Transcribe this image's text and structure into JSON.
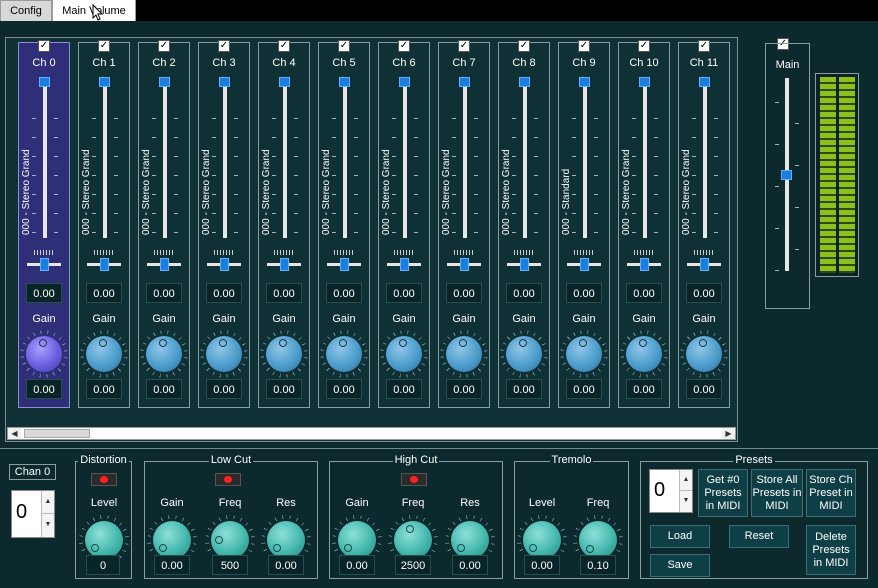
{
  "tabs": [
    {
      "label": "Config"
    },
    {
      "label": "Main Volume"
    }
  ],
  "channels": [
    {
      "label": "Ch 0",
      "preset": "000 - Stereo Grand",
      "pan_value": "0.00",
      "gain_label": "Gain",
      "gain_value": "0.00",
      "selected": true
    },
    {
      "label": "Ch 1",
      "preset": "000 - Stereo Grand",
      "pan_value": "0.00",
      "gain_label": "Gain",
      "gain_value": "0.00"
    },
    {
      "label": "Ch 2",
      "preset": "000 - Stereo Grand",
      "pan_value": "0.00",
      "gain_label": "Gain",
      "gain_value": "0.00"
    },
    {
      "label": "Ch 3",
      "preset": "000 - Stereo Grand",
      "pan_value": "0.00",
      "gain_label": "Gain",
      "gain_value": "0.00"
    },
    {
      "label": "Ch 4",
      "preset": "000 - Stereo Grand",
      "pan_value": "0.00",
      "gain_label": "Gain",
      "gain_value": "0.00"
    },
    {
      "label": "Ch 5",
      "preset": "000 - Stereo Grand",
      "pan_value": "0.00",
      "gain_label": "Gain",
      "gain_value": "0.00"
    },
    {
      "label": "Ch 6",
      "preset": "000 - Stereo Grand",
      "pan_value": "0.00",
      "gain_label": "Gain",
      "gain_value": "0.00"
    },
    {
      "label": "Ch 7",
      "preset": "000 - Stereo Grand",
      "pan_value": "0.00",
      "gain_label": "Gain",
      "gain_value": "0.00"
    },
    {
      "label": "Ch 8",
      "preset": "000 - Stereo Grand",
      "pan_value": "0.00",
      "gain_label": "Gain",
      "gain_value": "0.00"
    },
    {
      "label": "Ch 9",
      "preset": "000 - Standard",
      "pan_value": "0.00",
      "gain_label": "Gain",
      "gain_value": "0.00"
    },
    {
      "label": "Ch 10",
      "preset": "000 - Stereo Grand",
      "pan_value": "0.00",
      "gain_label": "Gain",
      "gain_value": "0.00"
    },
    {
      "label": "Ch 11",
      "preset": "000 - Stereo Grand",
      "pan_value": "0.00",
      "gain_label": "Gain",
      "gain_value": "0.00"
    }
  ],
  "main": {
    "label": "Main",
    "level_fraction": 0.5
  },
  "chan_selector": {
    "label": "Chan 0",
    "value": "0"
  },
  "distortion": {
    "title": "Distortion",
    "level_label": "Level",
    "level_value": "0"
  },
  "low_cut": {
    "title": "Low Cut",
    "gain_label": "Gain",
    "freq_label": "Freq",
    "res_label": "Res",
    "gain_value": "0.00",
    "freq_value": "500",
    "res_value": "0.00"
  },
  "high_cut": {
    "title": "High Cut",
    "gain_label": "Gain",
    "freq_label": "Freq",
    "res_label": "Res",
    "gain_value": "0.00",
    "freq_value": "2500",
    "res_value": "0.00"
  },
  "tremolo": {
    "title": "Tremolo",
    "level_label": "Level",
    "freq_label": "Freq",
    "level_value": "0.00",
    "freq_value": "0.10"
  },
  "presets": {
    "title": "Presets",
    "spin_value": "0",
    "get_label": "Get #0 Presets in MIDI",
    "store_all_label": "Store All Presets in MIDI",
    "store_ch_label": "Store Ch Preset in MIDI",
    "load_label": "Load",
    "reset_label": "Reset",
    "save_label": "Save",
    "delete_label": "Delete Presets in MIDI"
  },
  "colors": {
    "background": "#0c2a2e",
    "selected_strip": "#2e2f78",
    "slider": "#1a7ee0",
    "knob_blue": "#4d9dcc",
    "knob_teal": "#43b7ad",
    "meter": "#8fbf1a",
    "led": "#ff2020"
  }
}
